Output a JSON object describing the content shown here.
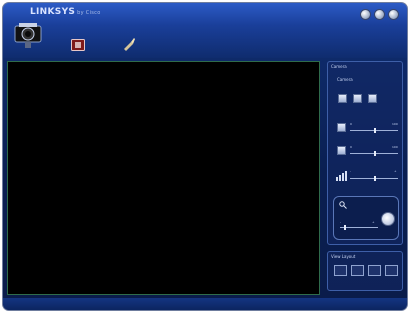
{
  "app": {
    "logo_text": "LINKSYS",
    "logo_by": "by Cisco"
  },
  "window_controls": [
    {
      "name": "minimize",
      "icon": "minimize-icon"
    },
    {
      "name": "maximize",
      "icon": "maximize-icon"
    },
    {
      "name": "close",
      "icon": "close-icon"
    }
  ],
  "toolbar": [
    {
      "name": "camera",
      "icon": "camera-icon"
    },
    {
      "name": "snapshot",
      "icon": "snapshot-icon"
    },
    {
      "name": "settings",
      "icon": "wrench-icon"
    }
  ],
  "video": {
    "state": "no-signal"
  },
  "controls_panel": {
    "title": "Camera",
    "subtitle": "Camera",
    "brightness": {
      "min": "0",
      "max": "100"
    },
    "contrast": {
      "min": "0",
      "max": "100"
    },
    "volume": {
      "min": "-",
      "max": "+"
    },
    "zoom": {
      "min": "-",
      "max": "+"
    }
  },
  "view_panel": {
    "title": "View Layout"
  },
  "colors": {
    "accent": "#1a3f9a",
    "background": "#0a1f52",
    "video_border": "#2f6b4b"
  }
}
